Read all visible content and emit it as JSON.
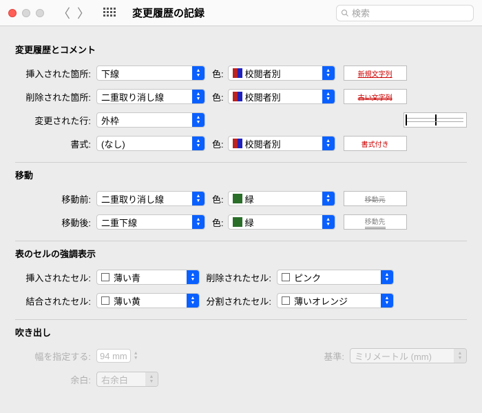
{
  "window": {
    "title": "変更履歴の記録",
    "search_placeholder": "検索"
  },
  "sections": {
    "changes_header": "変更履歴とコメント",
    "move_header": "移動",
    "cells_header": "表のセルの強調表示",
    "balloon_header": "吹き出し"
  },
  "labels": {
    "inserted": "挿入された箇所:",
    "deleted": "削除された箇所:",
    "changed_line": "変更された行:",
    "format": "書式:",
    "move_before": "移動前:",
    "move_after": "移動後:",
    "color": "色:",
    "inserted_cell": "挿入されたセル:",
    "deleted_cell": "削除されたセル:",
    "merged_cell": "結合されたセル:",
    "split_cell": "分割されたセル:",
    "width": "幅を指定する:",
    "standard": "基準:",
    "margin": "余白:"
  },
  "values": {
    "inserted_mark": "下線",
    "deleted_mark": "二重取り消し線",
    "changed_line_mark": "外枠",
    "format_mark": "(なし)",
    "color_by_reviewer": "校閲者別",
    "move_before_mark": "二重取り消し線",
    "move_after_mark": "二重下線",
    "color_green": "緑",
    "cell_light_blue": "薄い青",
    "cell_pink": "ピンク",
    "cell_light_yellow": "薄い黄",
    "cell_light_orange": "薄いオレンジ",
    "width_value": "94 mm",
    "unit": "ミリメートル (mm)",
    "margin_side": "右余白"
  },
  "previews": {
    "new_text": "新規文字列",
    "old_text": "古い文字列",
    "with_format": "書式付き",
    "move_src": "移動元",
    "move_dst": "移動先"
  }
}
